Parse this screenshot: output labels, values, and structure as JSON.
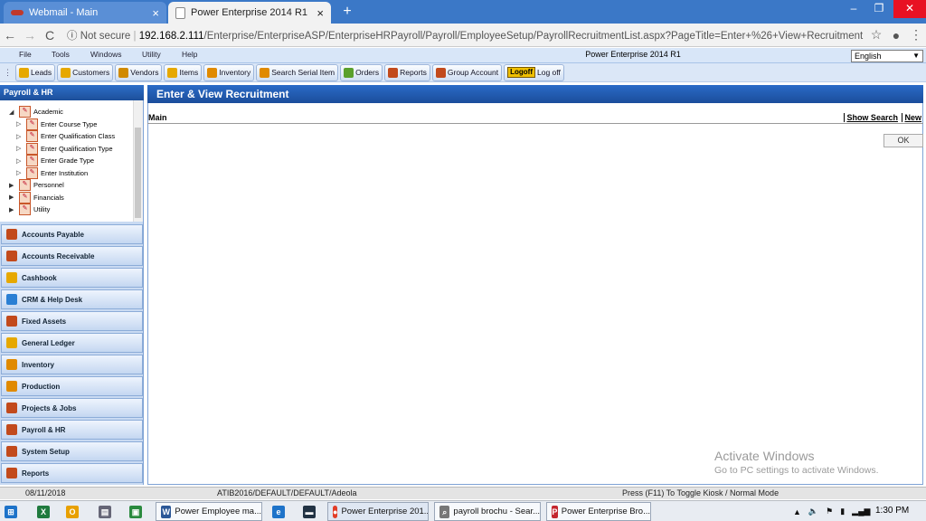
{
  "browser": {
    "tabs": [
      {
        "title": "Webmail - Main",
        "close": "×"
      },
      {
        "title": "Power Enterprise 2014 R1",
        "close": "×"
      }
    ],
    "new_tab": "+",
    "window_controls": {
      "minimize": "–",
      "maximize": "❐",
      "close": "✕"
    },
    "nav": {
      "back": "←",
      "forward": "→",
      "reload": "C"
    },
    "security_label": "Not secure",
    "url_domain": "192.168.2.111",
    "url_path": "/Enterprise/EnterpriseASP/EnterpriseHRPayroll/Payroll/EmployeeSetup/PayrollRecruitmentList.aspx?PageTitle=Enter+%26+View+Recruitment",
    "star": "☆",
    "account": "●",
    "kebab": "⋮"
  },
  "app": {
    "menu": [
      "File",
      "Tools",
      "Windows",
      "Utility",
      "Help"
    ],
    "title": "Power Enterprise 2014 R1",
    "language": "English",
    "toolbar": [
      {
        "label": "Leads",
        "icon": "leads-icon",
        "color": "#e6a800"
      },
      {
        "label": "Customers",
        "icon": "customers-icon",
        "color": "#e6a800"
      },
      {
        "label": "Vendors",
        "icon": "vendors-icon",
        "color": "#d08a00"
      },
      {
        "label": "Items",
        "icon": "items-icon",
        "color": "#e6a800"
      },
      {
        "label": "Inventory",
        "icon": "inventory-icon",
        "color": "#e08a00"
      },
      {
        "label": "Search Serial Item",
        "icon": "search-serial-icon",
        "color": "#e08a00"
      },
      {
        "label": "Orders",
        "icon": "orders-icon",
        "color": "#5aa02c"
      },
      {
        "label": "Reports",
        "icon": "reports-icon",
        "color": "#c24a1c"
      },
      {
        "label": "Group Account",
        "icon": "group-account-icon",
        "color": "#c24a1c"
      }
    ],
    "logoff_badge": "Logoff",
    "logoff_label": "Log off"
  },
  "sidebar": {
    "header": "Payroll & HR",
    "tree": [
      {
        "label": "Academic",
        "level": 1,
        "expanded": true
      },
      {
        "label": "Enter Course Type",
        "level": 2
      },
      {
        "label": "Enter Qualification Class",
        "level": 2
      },
      {
        "label": "Enter Qualification Type",
        "level": 2
      },
      {
        "label": "Enter Grade Type",
        "level": 2
      },
      {
        "label": "Enter Institution",
        "level": 2
      },
      {
        "label": "Personnel",
        "level": 1
      },
      {
        "label": "Financials",
        "level": 1
      },
      {
        "label": "Utility",
        "level": 1
      }
    ],
    "modules": [
      {
        "label": "Accounts Payable",
        "color": "#c24a1c"
      },
      {
        "label": "Accounts Receivable",
        "color": "#c24a1c"
      },
      {
        "label": "Cashbook",
        "color": "#e6a800"
      },
      {
        "label": "CRM & Help Desk",
        "color": "#2a7fd4"
      },
      {
        "label": "Fixed Assets",
        "color": "#c24a1c"
      },
      {
        "label": "General Ledger",
        "color": "#e6a800"
      },
      {
        "label": "Inventory",
        "color": "#e08a00"
      },
      {
        "label": "Production",
        "color": "#e08a00"
      },
      {
        "label": "Projects & Jobs",
        "color": "#c24a1c"
      },
      {
        "label": "Payroll & HR",
        "color": "#c24a1c"
      },
      {
        "label": "System Setup",
        "color": "#c24a1c"
      },
      {
        "label": "Reports",
        "color": "#c24a1c"
      }
    ]
  },
  "main": {
    "title": "Enter & View Recruitment",
    "section_label": "Main",
    "show_search": "Show Search",
    "new_link": "New",
    "ok_button": "OK"
  },
  "watermark": {
    "line1": "Activate Windows",
    "line2": "Go to PC settings to activate Windows."
  },
  "statusbar": {
    "date": "08/11/2018",
    "user": "ATIB2016/DEFAULT/DEFAULT/Adeola",
    "hint": "Press (F11) To Toggle Kiosk / Normal Mode"
  },
  "taskbar": {
    "windows": [
      {
        "title": "Power Employee ma...",
        "icon": "word-icon",
        "color": "#2b5797",
        "glyph": "W"
      },
      {
        "title": "Power Enterprise 201...",
        "icon": "chrome-icon",
        "color": "#e23d28",
        "glyph": "●"
      },
      {
        "title": "payroll brochu - Sear...",
        "icon": "search-icon",
        "color": "#777777",
        "glyph": "⌕"
      },
      {
        "title": "Power Enterprise Bro...",
        "icon": "pdf-icon",
        "color": "#c4262e",
        "glyph": "P"
      }
    ],
    "clock": "1:30 PM"
  }
}
